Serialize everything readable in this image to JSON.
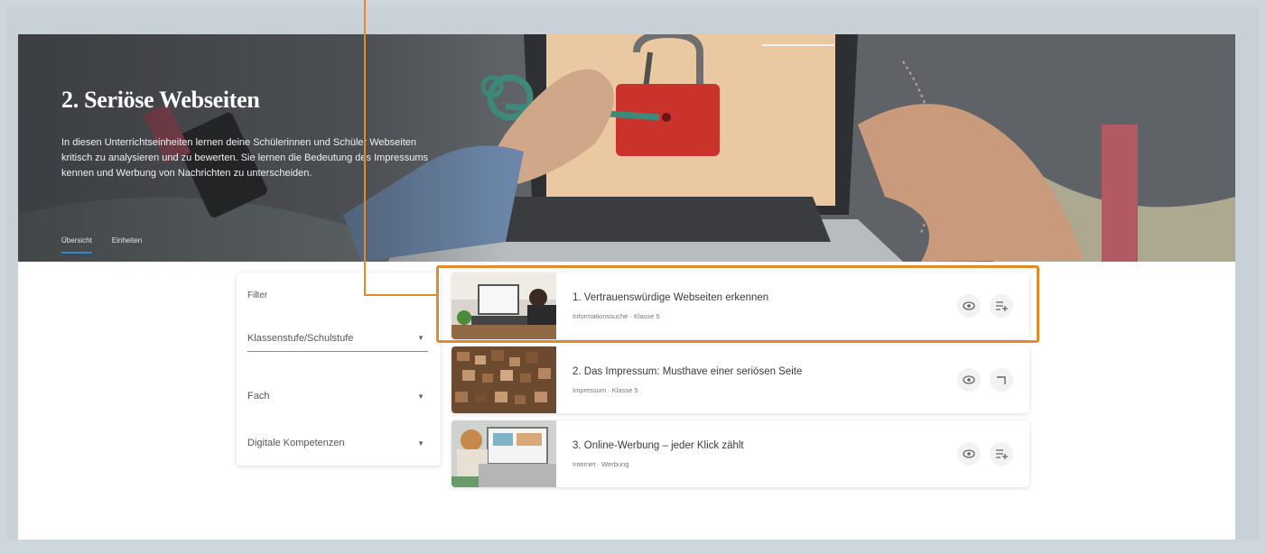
{
  "hero": {
    "title": "2. Seriöse Webseiten",
    "description": "In diesen Unterrichtseinheiten lernen deine Schülerinnen und Schüler Webseiten kritisch zu analysieren und zu bewerten. Sie lernen die Bedeutung des Impressums kennen und Werbung von Nachrichten zu unterscheiden.",
    "tabs": [
      {
        "label": "Übersicht",
        "active": true
      },
      {
        "label": "Einheiten",
        "active": false
      }
    ]
  },
  "filter": {
    "label": "Filter",
    "selects": [
      {
        "label": "Klassenstufe/Schulstufe"
      },
      {
        "label": "Fach"
      },
      {
        "label": "Digitale Kompetenzen"
      }
    ]
  },
  "cards": [
    {
      "title": "1. Vertrauenswürdige Webseiten erkennen",
      "subtitle": "Informationssuche · Klasse 5",
      "thumb": "laptop-desk",
      "actions": [
        "eye-icon",
        "playlist-add-icon"
      ]
    },
    {
      "title": "2. Das Impressum: Musthave einer seriösen Seite",
      "subtitle": "Impressum · Klasse 5",
      "thumb": "letter-stamps",
      "actions": [
        "eye-icon",
        "playlist-check-icon"
      ]
    },
    {
      "title": "3. Online-Werbung – jeder Klick zählt",
      "subtitle": "Internet · Werbung",
      "thumb": "laptop-outdoor",
      "actions": [
        "eye-icon",
        "playlist-add-icon"
      ]
    }
  ],
  "colors": {
    "highlight": "#e58a2b",
    "tab_accent": "#2c8ac9",
    "lock_red": "#c9332b"
  }
}
